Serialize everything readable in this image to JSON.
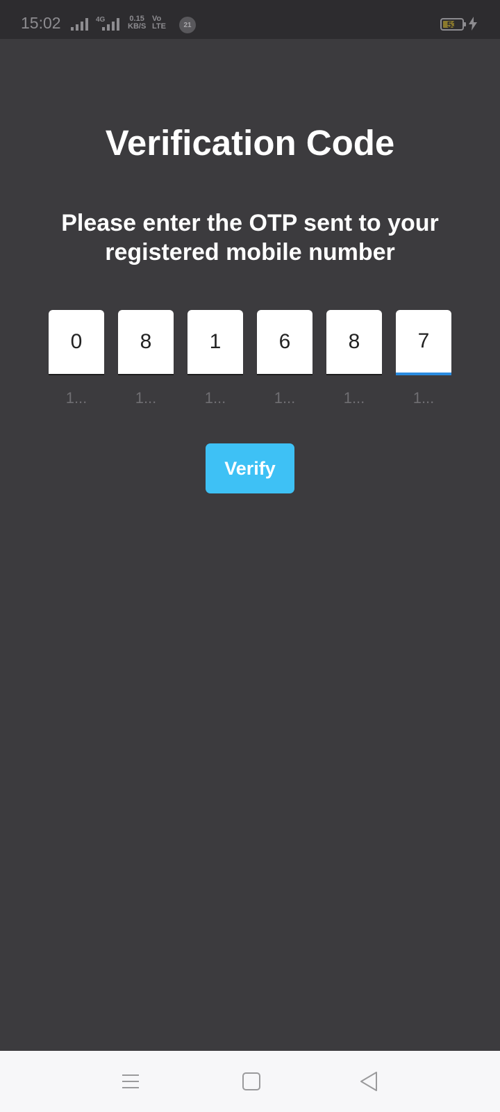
{
  "status_bar": {
    "time": "15:02",
    "network_type": "4G",
    "speed_value": "0.15",
    "speed_unit": "KB/S",
    "volte_top": "Vo",
    "volte_bottom": "LTE",
    "notification_count": "21",
    "battery_level": "53"
  },
  "screen": {
    "title": "Verification Code",
    "subtitle": "Please enter the OTP sent to your registered mobile number"
  },
  "otp": {
    "digits": [
      {
        "value": "0",
        "hint": "1..."
      },
      {
        "value": "8",
        "hint": "1..."
      },
      {
        "value": "1",
        "hint": "1..."
      },
      {
        "value": "6",
        "hint": "1..."
      },
      {
        "value": "8",
        "hint": "1..."
      },
      {
        "value": "7",
        "hint": "1..."
      }
    ],
    "active_index": 5,
    "active_color": "#2a8be0"
  },
  "actions": {
    "verify_label": "Verify",
    "verify_color": "#3ec1f5"
  },
  "nav_bar": {
    "icons": [
      "menu-icon",
      "home-icon",
      "back-icon"
    ]
  }
}
